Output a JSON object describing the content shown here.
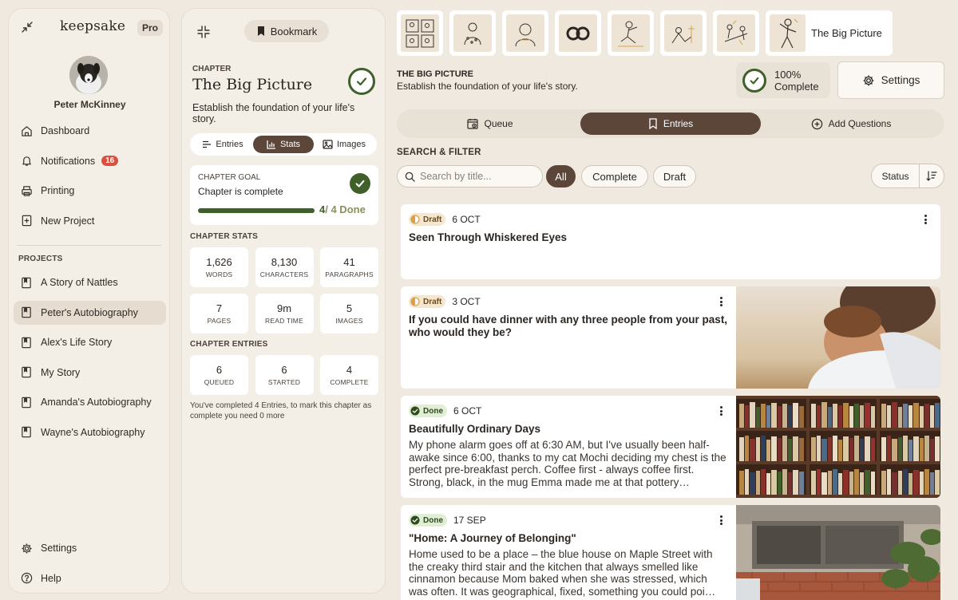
{
  "sidebar": {
    "logo": "keepsake",
    "plan_badge": "Pro",
    "user_name": "Peter McKinney",
    "nav": [
      {
        "label": "Dashboard",
        "icon": "home-icon"
      },
      {
        "label": "Notifications",
        "icon": "bell-icon",
        "count": "16"
      },
      {
        "label": "Printing",
        "icon": "printer-icon"
      },
      {
        "label": "New Project",
        "icon": "plus-square-icon"
      }
    ],
    "projects_heading": "PROJECTS",
    "projects": [
      {
        "label": "A Story of Nattles",
        "active": false
      },
      {
        "label": "Peter's Autobiography",
        "active": true
      },
      {
        "label": "Alex's Life Story",
        "active": false
      },
      {
        "label": "My Story",
        "active": false
      },
      {
        "label": "Amanda's Autobiography",
        "active": false
      },
      {
        "label": "Wayne's Autobiography",
        "active": false
      }
    ],
    "bottom": [
      {
        "label": "Settings",
        "icon": "gear-icon"
      },
      {
        "label": "Help",
        "icon": "help-icon"
      }
    ]
  },
  "chapter_panel": {
    "bookmark_label": "Bookmark",
    "chapter_label": "CHAPTER",
    "chapter_title": "The Big Picture",
    "chapter_desc": "Establish the foundation of your life's story.",
    "tabs": [
      {
        "label": "Entries",
        "active": false
      },
      {
        "label": "Stats",
        "active": true
      },
      {
        "label": "Images",
        "active": false
      }
    ],
    "goal": {
      "label": "CHAPTER GOAL",
      "text": "Chapter is complete",
      "done": "4",
      "total": "/ 4 Done",
      "progress": 1.0
    },
    "stats_heading": "CHAPTER STATS",
    "stats": [
      {
        "value": "1,626",
        "label": "WORDS"
      },
      {
        "value": "8,130",
        "label": "CHARACTERS"
      },
      {
        "value": "41",
        "label": "PARAGRAPHS"
      },
      {
        "value": "7",
        "label": "PAGES"
      },
      {
        "value": "9m",
        "label": "READ TIME"
      },
      {
        "value": "5",
        "label": "IMAGES"
      }
    ],
    "entries_heading": "CHAPTER ENTRIES",
    "entry_stats": [
      {
        "value": "6",
        "label": "QUEUED"
      },
      {
        "value": "6",
        "label": "STARTED"
      },
      {
        "value": "4",
        "label": "COMPLETE"
      }
    ],
    "entries_note": "You've completed 4 Entries, to mark this chapter as complete you need 0 more"
  },
  "main": {
    "chapter_thumb_label": "The Big Picture",
    "chapter_label": "THE BIG PICTURE",
    "chapter_desc": "Establish the foundation of your life's story.",
    "complete_pct": "100%",
    "complete_word": "Complete",
    "settings_label": "Settings",
    "tabs": [
      {
        "label": "Queue",
        "active": false
      },
      {
        "label": "Entries",
        "active": true
      },
      {
        "label": "Add Questions",
        "active": false
      }
    ],
    "filter_heading": "SEARCH & FILTER",
    "search_placeholder": "Search by title...",
    "filters": [
      {
        "label": "All",
        "active": true
      },
      {
        "label": "Complete",
        "active": false
      },
      {
        "label": "Draft",
        "active": false
      }
    ],
    "status_label": "Status",
    "entries": [
      {
        "status": "Draft",
        "date": "6 OCT",
        "title": "Seen Through Whiskered Eyes",
        "excerpt": "",
        "image": "none"
      },
      {
        "status": "Draft",
        "date": "3 OCT",
        "title": "If you could have dinner with any three people from your past, who would they be?",
        "excerpt": "",
        "image": "hug"
      },
      {
        "status": "Done",
        "date": "6 OCT",
        "title": "Beautifully Ordinary Days",
        "excerpt": "My phone alarm goes off at 6:30 AM, but I've usually been half-awake since 6:00, thanks to my cat Mochi deciding my chest is the perfect pre-breakfast perch. Coffee first - always coffee first. Strong, black, in the mug Emma made me at that pottery…",
        "image": "bookshelf"
      },
      {
        "status": "Done",
        "date": "17 SEP",
        "title": "\"Home: A Journey of Belonging\"",
        "excerpt": "Home used to be a place – the blue house on Maple Street with the creaky third stair and the kitchen that always smelled like cinnamon because Mom baked when she was stressed, which was often. It was geographical, fixed, something you could poi…",
        "image": "window"
      }
    ]
  },
  "colors": {
    "accent": "#5b4639",
    "success": "#3f5f2b",
    "notification": "#d9503f",
    "background": "#efe9df"
  }
}
